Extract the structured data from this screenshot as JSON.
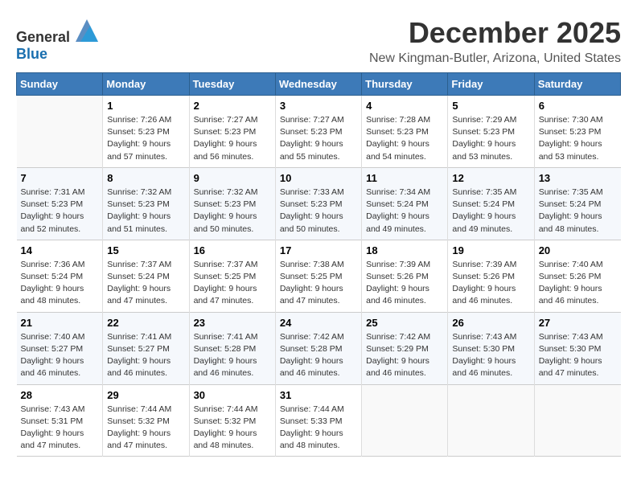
{
  "logo": {
    "text_general": "General",
    "text_blue": "Blue"
  },
  "title": "December 2025",
  "subtitle": "New Kingman-Butler, Arizona, United States",
  "days_header": [
    "Sunday",
    "Monday",
    "Tuesday",
    "Wednesday",
    "Thursday",
    "Friday",
    "Saturday"
  ],
  "weeks": [
    [
      {
        "day": "",
        "info": ""
      },
      {
        "day": "1",
        "info": "Sunrise: 7:26 AM\nSunset: 5:23 PM\nDaylight: 9 hours\nand 57 minutes."
      },
      {
        "day": "2",
        "info": "Sunrise: 7:27 AM\nSunset: 5:23 PM\nDaylight: 9 hours\nand 56 minutes."
      },
      {
        "day": "3",
        "info": "Sunrise: 7:27 AM\nSunset: 5:23 PM\nDaylight: 9 hours\nand 55 minutes."
      },
      {
        "day": "4",
        "info": "Sunrise: 7:28 AM\nSunset: 5:23 PM\nDaylight: 9 hours\nand 54 minutes."
      },
      {
        "day": "5",
        "info": "Sunrise: 7:29 AM\nSunset: 5:23 PM\nDaylight: 9 hours\nand 53 minutes."
      },
      {
        "day": "6",
        "info": "Sunrise: 7:30 AM\nSunset: 5:23 PM\nDaylight: 9 hours\nand 53 minutes."
      }
    ],
    [
      {
        "day": "7",
        "info": "Sunrise: 7:31 AM\nSunset: 5:23 PM\nDaylight: 9 hours\nand 52 minutes."
      },
      {
        "day": "8",
        "info": "Sunrise: 7:32 AM\nSunset: 5:23 PM\nDaylight: 9 hours\nand 51 minutes."
      },
      {
        "day": "9",
        "info": "Sunrise: 7:32 AM\nSunset: 5:23 PM\nDaylight: 9 hours\nand 50 minutes."
      },
      {
        "day": "10",
        "info": "Sunrise: 7:33 AM\nSunset: 5:23 PM\nDaylight: 9 hours\nand 50 minutes."
      },
      {
        "day": "11",
        "info": "Sunrise: 7:34 AM\nSunset: 5:24 PM\nDaylight: 9 hours\nand 49 minutes."
      },
      {
        "day": "12",
        "info": "Sunrise: 7:35 AM\nSunset: 5:24 PM\nDaylight: 9 hours\nand 49 minutes."
      },
      {
        "day": "13",
        "info": "Sunrise: 7:35 AM\nSunset: 5:24 PM\nDaylight: 9 hours\nand 48 minutes."
      }
    ],
    [
      {
        "day": "14",
        "info": "Sunrise: 7:36 AM\nSunset: 5:24 PM\nDaylight: 9 hours\nand 48 minutes."
      },
      {
        "day": "15",
        "info": "Sunrise: 7:37 AM\nSunset: 5:24 PM\nDaylight: 9 hours\nand 47 minutes."
      },
      {
        "day": "16",
        "info": "Sunrise: 7:37 AM\nSunset: 5:25 PM\nDaylight: 9 hours\nand 47 minutes."
      },
      {
        "day": "17",
        "info": "Sunrise: 7:38 AM\nSunset: 5:25 PM\nDaylight: 9 hours\nand 47 minutes."
      },
      {
        "day": "18",
        "info": "Sunrise: 7:39 AM\nSunset: 5:26 PM\nDaylight: 9 hours\nand 46 minutes."
      },
      {
        "day": "19",
        "info": "Sunrise: 7:39 AM\nSunset: 5:26 PM\nDaylight: 9 hours\nand 46 minutes."
      },
      {
        "day": "20",
        "info": "Sunrise: 7:40 AM\nSunset: 5:26 PM\nDaylight: 9 hours\nand 46 minutes."
      }
    ],
    [
      {
        "day": "21",
        "info": "Sunrise: 7:40 AM\nSunset: 5:27 PM\nDaylight: 9 hours\nand 46 minutes."
      },
      {
        "day": "22",
        "info": "Sunrise: 7:41 AM\nSunset: 5:27 PM\nDaylight: 9 hours\nand 46 minutes."
      },
      {
        "day": "23",
        "info": "Sunrise: 7:41 AM\nSunset: 5:28 PM\nDaylight: 9 hours\nand 46 minutes."
      },
      {
        "day": "24",
        "info": "Sunrise: 7:42 AM\nSunset: 5:28 PM\nDaylight: 9 hours\nand 46 minutes."
      },
      {
        "day": "25",
        "info": "Sunrise: 7:42 AM\nSunset: 5:29 PM\nDaylight: 9 hours\nand 46 minutes."
      },
      {
        "day": "26",
        "info": "Sunrise: 7:43 AM\nSunset: 5:30 PM\nDaylight: 9 hours\nand 46 minutes."
      },
      {
        "day": "27",
        "info": "Sunrise: 7:43 AM\nSunset: 5:30 PM\nDaylight: 9 hours\nand 47 minutes."
      }
    ],
    [
      {
        "day": "28",
        "info": "Sunrise: 7:43 AM\nSunset: 5:31 PM\nDaylight: 9 hours\nand 47 minutes."
      },
      {
        "day": "29",
        "info": "Sunrise: 7:44 AM\nSunset: 5:32 PM\nDaylight: 9 hours\nand 47 minutes."
      },
      {
        "day": "30",
        "info": "Sunrise: 7:44 AM\nSunset: 5:32 PM\nDaylight: 9 hours\nand 48 minutes."
      },
      {
        "day": "31",
        "info": "Sunrise: 7:44 AM\nSunset: 5:33 PM\nDaylight: 9 hours\nand 48 minutes."
      },
      {
        "day": "",
        "info": ""
      },
      {
        "day": "",
        "info": ""
      },
      {
        "day": "",
        "info": ""
      }
    ]
  ]
}
